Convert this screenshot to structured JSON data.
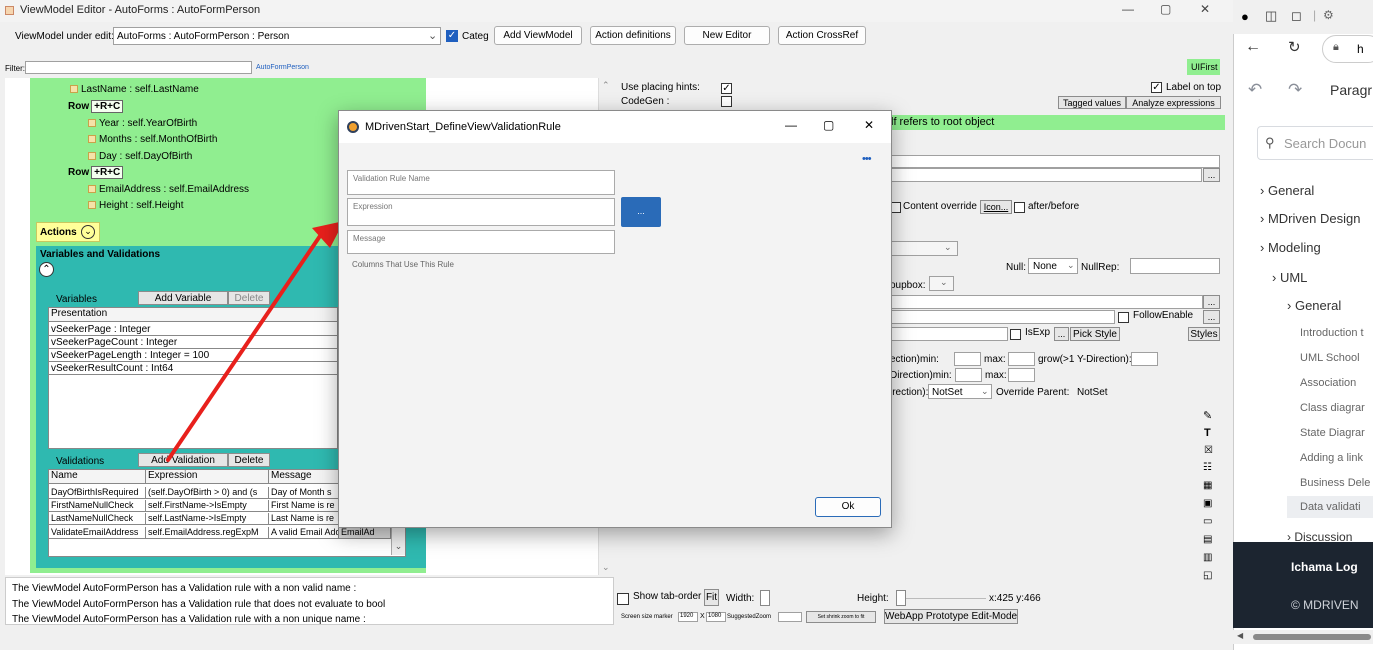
{
  "window": {
    "title": "ViewModel Editor - AutoForms : AutoFormPerson",
    "min": "—",
    "max": "▢",
    "close": "✕"
  },
  "toolbar": {
    "vm_label": "ViewModel under edit:",
    "vm_value": "AutoForms : AutoFormPerson : Person",
    "categ": "Categ",
    "add_vm": "Add ViewModel",
    "action_defs": "Action definitions",
    "new_editor": "New Editor",
    "action_crossref": "Action CrossRef"
  },
  "filter": {
    "label": "Filter:",
    "value": "",
    "link": "AutoFormPerson",
    "uifirst": "UIFirst"
  },
  "tree": {
    "lastname": "LastName : self.LastName",
    "row1": "Row",
    "rc": "+R+C",
    "year": "Year : self.YearOfBirth",
    "months": "Months : self.MonthOfBirth",
    "day": "Day : self.DayOfBirth",
    "row2": "Row",
    "email": "EmailAddress : self.EmailAddress",
    "height": "Height : self.Height",
    "actions": "Actions",
    "varval": "Variables and Validations"
  },
  "variables": {
    "tab": "Variables",
    "add": "Add Variable",
    "del": "Delete",
    "header": "Presentation",
    "items": [
      "vSeekerPage : Integer",
      "vSeekerPageCount : Integer",
      "vSeekerPageLength : Integer = 100",
      "vSeekerResultCount : Int64"
    ]
  },
  "validations": {
    "tab": "Validations",
    "add": "Add Validation",
    "del": "Delete",
    "headers": [
      "Name",
      "Expression",
      "Message"
    ],
    "rows": [
      [
        "DayOfBirthIsRequired",
        "(self.DayOfBirth > 0) and (s",
        "Day of Month s"
      ],
      [
        "FirstNameNullCheck",
        "self.FirstName->IsEmpty",
        "First Name is re"
      ],
      [
        "LastNameNullCheck",
        "self.LastName->IsEmpty",
        "Last Name is re"
      ],
      [
        "ValidateEmailAddress",
        "self.EmailAddress.regExpM",
        "A valid Email Add"
      ]
    ],
    "extra": "EmailAd"
  },
  "messages": [
    "The ViewModel AutoFormPerson has a Validation rule with a non valid name :",
    "The ViewModel AutoFormPerson has a Validation rule  that does not evaluate to bool",
    "The ViewModel AutoFormPerson has a Validation rule with a non unique name :"
  ],
  "props": {
    "placing": "Use placing hints:",
    "codegen": "CodeGen :",
    "label_on_top": "Label on top",
    "tagged": "Tagged values",
    "analyze": "Analyze expressions",
    "self_root": "lf refers to root object",
    "content_override": "Content override",
    "icon": "Icon...",
    "after_before": "after/before",
    "null_label": "Null:",
    "null_val": "None",
    "nullrep": "NullRep:",
    "groupbox": "oupbox:",
    "follow": "FollowEnable",
    "isexp": "IsExp",
    "pick_style": "Pick Style",
    "styles": "Styles",
    "ymin": "ection)min:",
    "max1": "max:",
    "grow": "grow(>1 Y-Direction):",
    "xmin": "Direction)min:",
    "max2": "max:",
    "xdir": "irection):",
    "notset": "NotSet",
    "override": "Override Parent:",
    "override_val": "NotSet",
    "ellipsis": "...",
    "ellipsis2": "..."
  },
  "bottom": {
    "show_tab": "Show tab-order",
    "fit": "Fit",
    "width": "Width:",
    "height": "Height:",
    "coords": "x:425 y:466",
    "marker": "Screen size marker",
    "w1920": "1920",
    "x": "X",
    "h1080": "1080",
    "suggested": "SuggestedZoom",
    "shrink": "Set shrink zoom to fit",
    "webapp": "WebApp Prototype Edit-Mode"
  },
  "dialog": {
    "title": "MDrivenStart_DefineViewValidationRule",
    "more": "•••",
    "name_ph": "Validation Rule Name",
    "expr_ph": "Expression",
    "msg_ph": "Message",
    "columns": "Columns That Use This Rule",
    "btn": "...",
    "ok": "Ok",
    "min": "—",
    "max": "▢",
    "close": "✕"
  },
  "browser": {
    "url": "h",
    "title_frag": "Paragr",
    "search": "Search Docun",
    "nav": [
      "General",
      "MDriven Design",
      "Modeling",
      "UML",
      "General",
      "Introduction t",
      "UML School",
      "Association",
      "Class diagrar",
      "State Diagrar",
      "Adding a link",
      "Business Dele",
      "Data validati",
      "Discussion"
    ],
    "footer1": "Ichama  Log",
    "footer2": "© MDRIVEN"
  },
  "colors": {
    "green": "#90ee90",
    "teal": "#2fb9b0",
    "arrow": "#e8201c",
    "accent": "#1f5fbf",
    "dark": "#1c2530"
  }
}
